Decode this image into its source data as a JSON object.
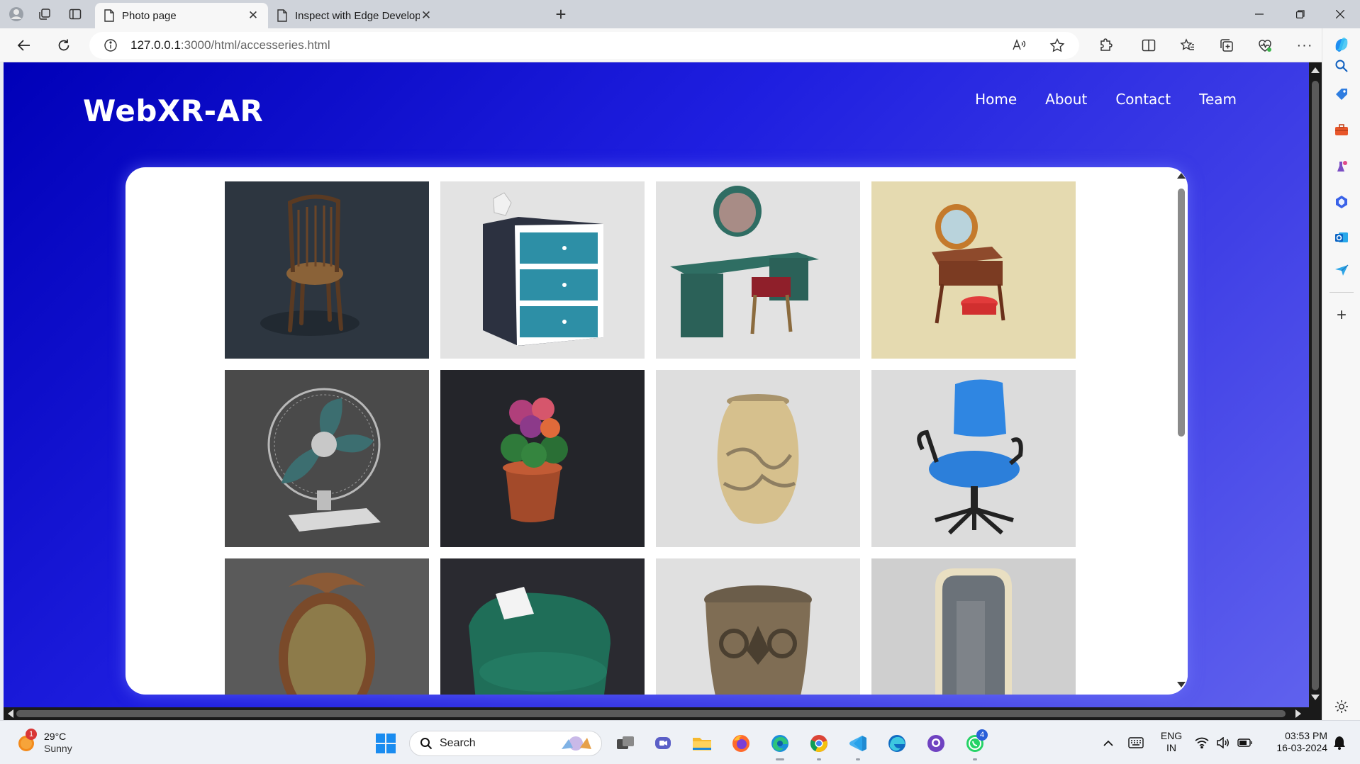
{
  "browser": {
    "tabs": [
      {
        "title": "Photo page",
        "active": true
      },
      {
        "title": "Inspect with Edge Developer Tools",
        "active": false
      }
    ],
    "address": {
      "host": "127.0.0.1",
      "rest": ":3000/html/accesseries.html"
    }
  },
  "site": {
    "logo": "WebXR-AR",
    "nav": [
      "Home",
      "About",
      "Contact",
      "Team"
    ]
  },
  "gallery": [
    {
      "name": "Wooden chair",
      "bg": "#2d3640"
    },
    {
      "name": "Drawer cabinet",
      "bg": "#e3e3e3"
    },
    {
      "name": "Dressing table",
      "bg": "#e2e2e2"
    },
    {
      "name": "Vanity with stool",
      "bg": "#e5dab0"
    },
    {
      "name": "Table fan",
      "bg": "#4a4a4a"
    },
    {
      "name": "Flower pot",
      "bg": "#24252a"
    },
    {
      "name": "Ceramic vase",
      "bg": "#dedede"
    },
    {
      "name": "Office chair",
      "bg": "#dcdcdc"
    },
    {
      "name": "Ornate mirror",
      "bg": "#5a5a5a"
    },
    {
      "name": "Armchair",
      "bg": "#2a2a30"
    },
    {
      "name": "Carved pot",
      "bg": "#e0e0e0"
    },
    {
      "name": "Floor mirror",
      "bg": "#cfcfcf"
    }
  ],
  "taskbar": {
    "weather": {
      "temp": "29°C",
      "condition": "Sunny",
      "badge": "1"
    },
    "search_placeholder": "Search",
    "language": {
      "lang": "ENG",
      "region": "IN"
    },
    "clock": {
      "time": "03:53 PM",
      "date": "16-03-2024"
    },
    "whatsapp_badge": "4"
  }
}
